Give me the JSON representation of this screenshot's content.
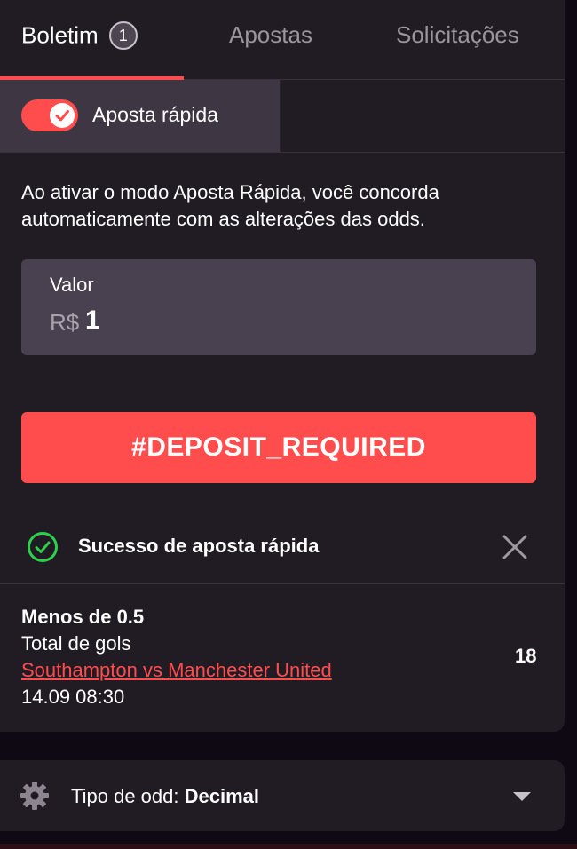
{
  "tabs": [
    {
      "label": "Boletim",
      "badge": "1",
      "active": true
    },
    {
      "label": "Apostas"
    },
    {
      "label": "Solicitações"
    }
  ],
  "quick_bet": {
    "label": "Aposta rápida",
    "enabled": true
  },
  "info_text": "Ao ativar o modo Aposta Rápida, você concorda automaticamente com as alterações das odds.",
  "amount": {
    "label": "Valor",
    "currency": "R$",
    "value": "1"
  },
  "deposit_button": "#DEPOSIT_REQUIRED",
  "success": {
    "message": "Sucesso de aposta rápida"
  },
  "bet": {
    "market": "Menos de 0.5",
    "type": "Total de gols",
    "match": "Southampton vs Manchester United",
    "date": "14.09 08:30",
    "odd": "18"
  },
  "settings": {
    "odd_type_label": "Tipo de odd:",
    "odd_type_value": "Decimal"
  },
  "colors": {
    "accent": "#ff4d4d",
    "success": "#2bd14a",
    "panel": "#211b23",
    "background": "#0f0913"
  }
}
